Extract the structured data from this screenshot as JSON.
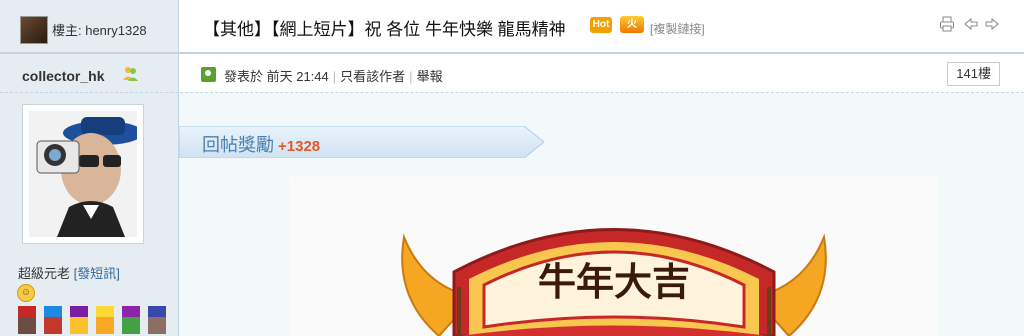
{
  "topbar": {
    "op_label": "樓主: henry1328",
    "thread_title": "【其他】【網上短片】祝 各位 牛年快樂 龍馬精神",
    "copy_link": "[複製鏈接]",
    "badge_hot": "Hot",
    "badge_fire": "火"
  },
  "sidebar": {
    "username": "collector_hk",
    "rank": "超級元老",
    "pm_link": "[發短訊]"
  },
  "post": {
    "posted": "發表於 前天 21:44",
    "only_author": "只看該作者",
    "report": "舉報",
    "floor": "141樓",
    "reward_label": "回帖獎勵",
    "reward_amount": "+1328"
  },
  "image": {
    "banner_text": "牛年大吉"
  },
  "colors": {
    "sidebar_bg": "#e5edf2",
    "border": "#c2d5e3",
    "link_blue": "#336699",
    "reward_orange": "#e05a2a"
  }
}
